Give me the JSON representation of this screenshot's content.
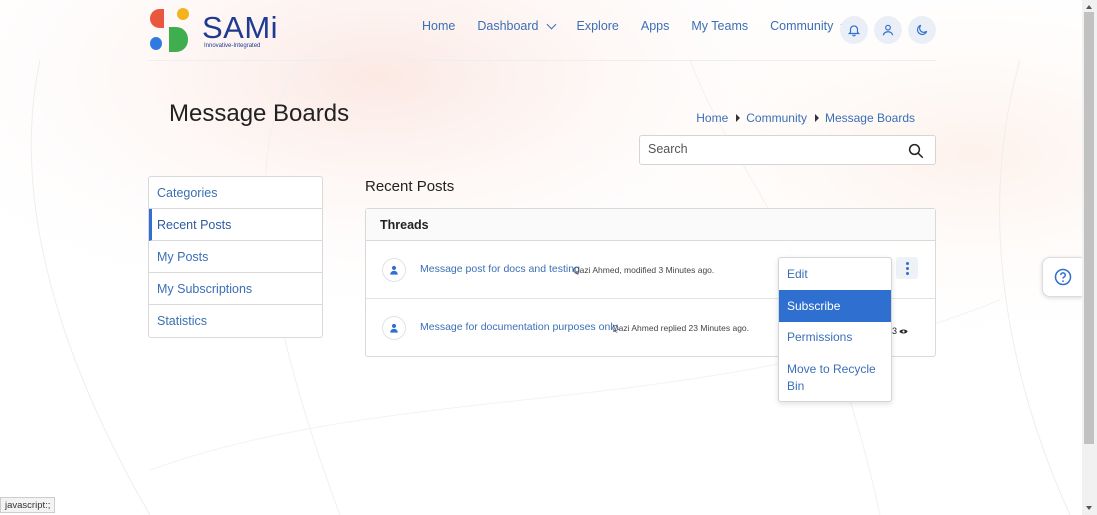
{
  "brand": {
    "name": "SAMi",
    "tagline": "Innovative-Integrated"
  },
  "nav": {
    "items": [
      {
        "label": "Home",
        "dropdown": false
      },
      {
        "label": "Dashboard",
        "dropdown": true
      },
      {
        "label": "Explore",
        "dropdown": false
      },
      {
        "label": "Apps",
        "dropdown": false
      },
      {
        "label": "My Teams",
        "dropdown": false
      },
      {
        "label": "Community",
        "dropdown": true
      }
    ],
    "icons": [
      "bell-icon",
      "user-icon",
      "moon-icon"
    ]
  },
  "page": {
    "title": "Message Boards"
  },
  "breadcrumb": {
    "items": [
      "Home",
      "Community",
      "Message Boards"
    ]
  },
  "search": {
    "placeholder": "Search"
  },
  "sidebar": {
    "items": [
      {
        "label": "Categories"
      },
      {
        "label": "Recent Posts",
        "active": true
      },
      {
        "label": "My Posts"
      },
      {
        "label": "My Subscriptions"
      },
      {
        "label": "Statistics"
      }
    ]
  },
  "main": {
    "section_title": "Recent Posts",
    "threads_header": "Threads",
    "threads": [
      {
        "title": "Message post for docs and testing",
        "meta": "Qazi Ahmed, modified 3 Minutes ago."
      },
      {
        "title": "Message for documentation purposes only.",
        "meta": "Qazi Ahmed replied 23 Minutes ago.",
        "views": "3"
      }
    ]
  },
  "dropdown": {
    "items": [
      "Edit",
      "Subscribe",
      "Permissions",
      "Move to Recycle Bin"
    ],
    "highlighted": "Subscribe"
  },
  "status_bar": {
    "text": "javascript:;"
  },
  "colors": {
    "accent": "#2f6fd0",
    "link": "#3b6fb6",
    "brand": "#1f3a93"
  }
}
